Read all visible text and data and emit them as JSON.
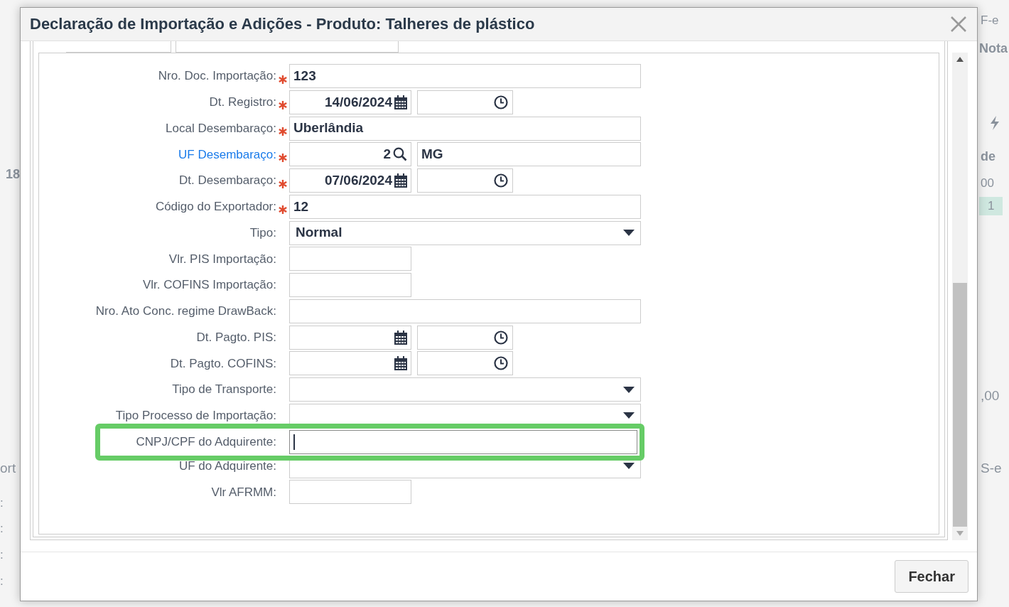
{
  "window": {
    "title": "Declaração de Importação e Adições - Produto: Talheres de plástico"
  },
  "fields": [
    {
      "kind": "text",
      "label": "Nro. Doc. Importação:",
      "link": false,
      "required": true,
      "focused": false,
      "highlighted": false,
      "value": "123"
    },
    {
      "kind": "datetime",
      "label": "Dt. Registro:",
      "link": false,
      "required": true,
      "focused": false,
      "highlighted": false,
      "value": "14/06/2024"
    },
    {
      "kind": "text",
      "label": "Local Desembaraço:",
      "link": false,
      "required": true,
      "focused": false,
      "highlighted": false,
      "value": "Uberlândia"
    },
    {
      "kind": "lookup",
      "label": "UF Desembaraço:",
      "link": true,
      "required": true,
      "focused": false,
      "highlighted": false,
      "value": "2",
      "description": "MG"
    },
    {
      "kind": "datetime",
      "label": "Dt. Desembaraço:",
      "link": false,
      "required": true,
      "focused": false,
      "highlighted": false,
      "value": "07/06/2024"
    },
    {
      "kind": "text",
      "label": "Código do Exportador:",
      "link": false,
      "required": true,
      "focused": false,
      "highlighted": false,
      "value": "12"
    },
    {
      "kind": "select",
      "label": "Tipo:",
      "link": false,
      "required": false,
      "focused": false,
      "highlighted": false,
      "value": "Normal"
    },
    {
      "kind": "short",
      "label": "Vlr. PIS Importação:",
      "link": false,
      "required": false,
      "focused": false,
      "highlighted": false
    },
    {
      "kind": "short",
      "label": "Vlr. COFINS Importação:",
      "link": false,
      "required": false,
      "focused": false,
      "highlighted": false
    },
    {
      "kind": "text",
      "label": "Nro. Ato Conc. regime DrawBack:",
      "link": false,
      "required": false,
      "focused": false,
      "highlighted": false
    },
    {
      "kind": "datetime",
      "label": "Dt. Pagto. PIS:",
      "link": false,
      "required": false,
      "focused": false,
      "highlighted": false
    },
    {
      "kind": "datetime",
      "label": "Dt. Pagto. COFINS:",
      "link": false,
      "required": false,
      "focused": false,
      "highlighted": false
    },
    {
      "kind": "select",
      "label": "Tipo de Transporte:",
      "link": false,
      "required": false,
      "focused": false,
      "highlighted": false
    },
    {
      "kind": "select",
      "label": "Tipo Processo de Importação:",
      "link": false,
      "required": false,
      "focused": false,
      "highlighted": false
    },
    {
      "kind": "text",
      "label": "CNPJ/CPF do Adquirente:",
      "link": false,
      "required": false,
      "focused": true,
      "highlighted": true
    },
    {
      "kind": "select",
      "label": "UF do Adquirente:",
      "link": false,
      "required": false,
      "focused": false,
      "highlighted": false
    },
    {
      "kind": "short",
      "label": "Vlr AFRMM:",
      "link": false,
      "required": false,
      "focused": false,
      "highlighted": false
    }
  ],
  "footer": {
    "buttons": [
      "Fechar"
    ]
  },
  "background": {
    "fragments": [
      {
        "kind": "text",
        "text": "F-e"
      },
      {
        "kind": "bold",
        "text": "Nota"
      },
      {
        "kind": "bolt"
      },
      {
        "kind": "bold",
        "text": "de"
      },
      {
        "kind": "bold",
        "text": "18"
      },
      {
        "kind": "text",
        "text": "00"
      },
      {
        "kind": "cell",
        "text": "1"
      },
      {
        "kind": "big",
        "text": ",00"
      },
      {
        "kind": "big",
        "text": "ort"
      },
      {
        "kind": "big",
        "text": "S-e"
      },
      {
        "kind": "text",
        "text": ":"
      },
      {
        "kind": "text",
        "text": ":"
      },
      {
        "kind": "text",
        "text": ":"
      },
      {
        "kind": "text",
        "text": ":"
      }
    ]
  }
}
